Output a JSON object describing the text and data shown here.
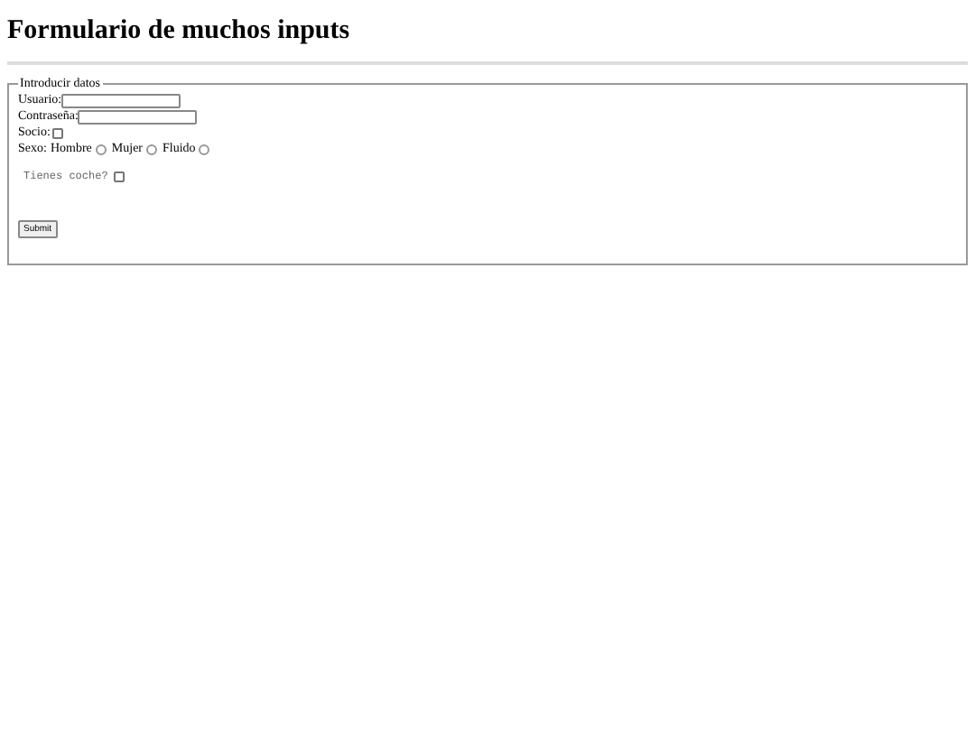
{
  "title": "Formulario de muchos inputs",
  "legend": "Introducir datos",
  "fields": [
    {
      "label": "Usuario:"
    },
    {
      "label": "Contraseña:"
    }
  ],
  "socio": {
    "label": "Socio:",
    "checked": false
  },
  "sexo": {
    "label": "Sexo:",
    "options": [
      {
        "label": "Hombre",
        "selected": false
      },
      {
        "label": "Mujer",
        "selected": false
      },
      {
        "label": "Fluido",
        "selected": false
      }
    ]
  },
  "coche": {
    "label": "Tienes coche?",
    "checked": false
  },
  "submit": "Submit"
}
